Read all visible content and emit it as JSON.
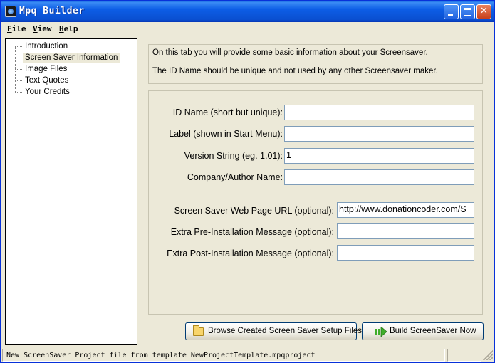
{
  "window": {
    "title": "Mpq Builder"
  },
  "menu": {
    "file": {
      "accel": "F",
      "rest": "ile"
    },
    "view": {
      "accel": "V",
      "rest": "iew"
    },
    "help": {
      "accel": "H",
      "rest": "elp"
    }
  },
  "tree": {
    "items": [
      {
        "label": "Introduction",
        "selected": false
      },
      {
        "label": "Screen Saver Information",
        "selected": true
      },
      {
        "label": "Image Files",
        "selected": false
      },
      {
        "label": "Text Quotes",
        "selected": false
      },
      {
        "label": "Your Credits",
        "selected": false
      }
    ]
  },
  "info": {
    "line1": "On this tab you will provide some basic information about your Screensaver.",
    "line2": "The ID Name should be unique and not used by any other Screensaver maker."
  },
  "form": {
    "id_name": {
      "label": "ID Name (short but unique):",
      "value": ""
    },
    "label": {
      "label": "Label (shown in Start Menu):",
      "value": ""
    },
    "version": {
      "label": "Version String (eg. 1.01):",
      "value": "1"
    },
    "company": {
      "label": "Company/Author Name:",
      "value": ""
    },
    "url": {
      "label": "Screen Saver Web Page URL (optional):",
      "value": "http://www.donationcoder.com/S"
    },
    "pre_msg": {
      "label": "Extra Pre-Installation Message (optional):",
      "value": ""
    },
    "post_msg": {
      "label": "Extra Post-Installation Message (optional):",
      "value": ""
    }
  },
  "buttons": {
    "browse": "Browse Created Screen Saver Setup Files",
    "build": "Build ScreenSaver Now"
  },
  "status": {
    "text": "New ScreenSaver Project file from template NewProjectTemplate.mpqproject"
  },
  "colors": {
    "titlebar": "#0a4fd0",
    "window_bg": "#ece9d8",
    "build_icon": "#3fae2a"
  }
}
